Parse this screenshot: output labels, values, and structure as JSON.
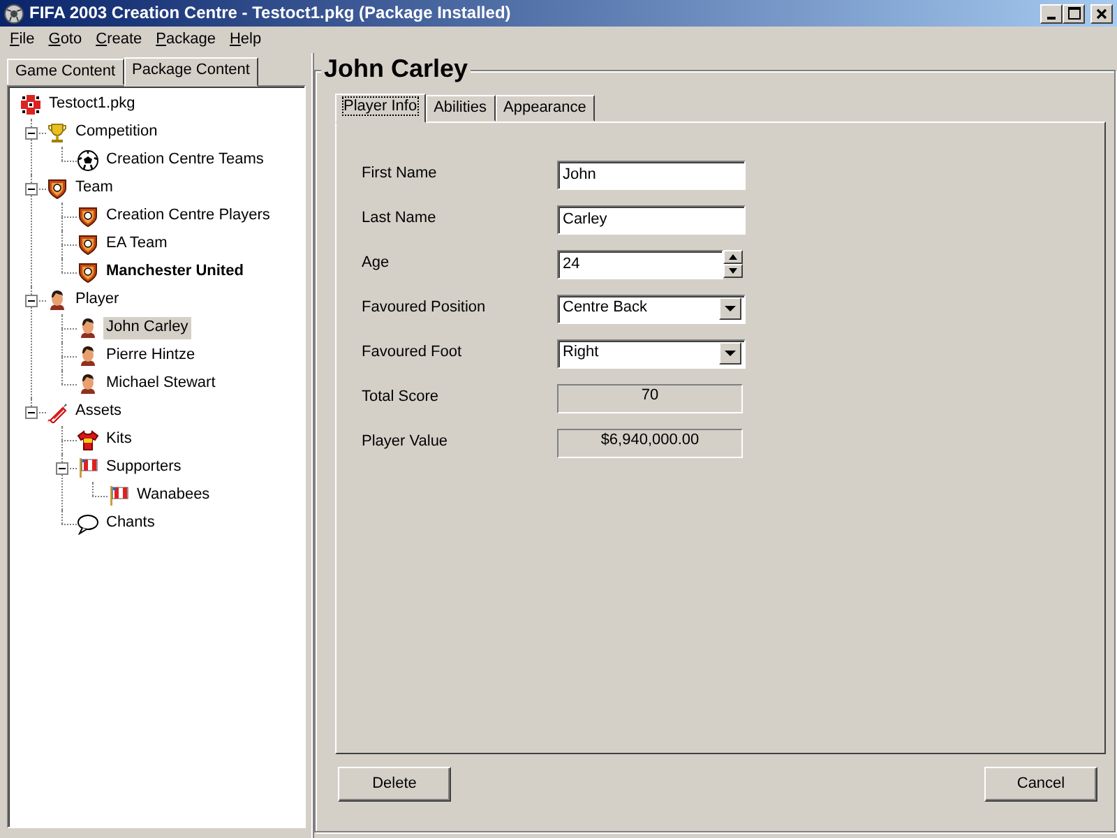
{
  "window": {
    "title": "FIFA 2003 Creation Centre - Testoct1.pkg (Package Installed)"
  },
  "menu": [
    "File",
    "Goto",
    "Create",
    "Package",
    "Help"
  ],
  "left_tabs": [
    {
      "label": "Game Content",
      "selected": false
    },
    {
      "label": "Package Content",
      "selected": true
    }
  ],
  "tree": {
    "label": "Testoct1.pkg",
    "kind": "package",
    "selected": false,
    "bold": false,
    "children": [
      {
        "label": "Competition",
        "kind": "trophy",
        "selected": false,
        "bold": false,
        "expanded": true,
        "children": [
          {
            "label": "Creation Centre Teams",
            "kind": "ball",
            "selected": false,
            "bold": false
          }
        ]
      },
      {
        "label": "Team",
        "kind": "shield",
        "selected": false,
        "bold": false,
        "expanded": true,
        "children": [
          {
            "label": "Creation Centre Players",
            "kind": "shield",
            "selected": false,
            "bold": false
          },
          {
            "label": "EA Team",
            "kind": "shield",
            "selected": false,
            "bold": false
          },
          {
            "label": "Manchester United",
            "kind": "shield",
            "selected": false,
            "bold": true
          }
        ]
      },
      {
        "label": "Player",
        "kind": "person",
        "selected": false,
        "bold": false,
        "expanded": true,
        "children": [
          {
            "label": "John Carley",
            "kind": "person",
            "selected": true,
            "bold": false
          },
          {
            "label": "Pierre Hintze",
            "kind": "person",
            "selected": false,
            "bold": false
          },
          {
            "label": "Michael Stewart",
            "kind": "person",
            "selected": false,
            "bold": false
          }
        ]
      },
      {
        "label": "Assets",
        "kind": "tube",
        "selected": false,
        "bold": false,
        "expanded": true,
        "children": [
          {
            "label": "Kits",
            "kind": "shirt",
            "selected": false,
            "bold": false
          },
          {
            "label": "Supporters",
            "kind": "flag",
            "selected": false,
            "bold": false,
            "expanded": true,
            "children": [
              {
                "label": "Wanabees",
                "kind": "flag",
                "selected": false,
                "bold": false
              }
            ]
          },
          {
            "label": "Chants",
            "kind": "bubble",
            "selected": false,
            "bold": false
          }
        ]
      }
    ]
  },
  "detail": {
    "title": "John Carley",
    "tabs": [
      {
        "label": "Player Info",
        "selected": true
      },
      {
        "label": "Abilities",
        "selected": false
      },
      {
        "label": "Appearance",
        "selected": false
      }
    ],
    "fields": [
      {
        "label": "First Name",
        "kind": "text",
        "value": "John"
      },
      {
        "label": "Last Name",
        "kind": "text",
        "value": "Carley"
      },
      {
        "label": "Age",
        "kind": "spinner",
        "value": "24"
      },
      {
        "label": "Favoured Position",
        "kind": "select",
        "value": "Centre Back"
      },
      {
        "label": "Favoured Foot",
        "kind": "select",
        "value": "Right"
      },
      {
        "label": "Total Score",
        "kind": "readonly",
        "value": "70"
      },
      {
        "label": "Player Value",
        "kind": "readonly",
        "value": "$6,940,000.00"
      }
    ],
    "buttons": [
      "Delete",
      "Cancel"
    ]
  }
}
